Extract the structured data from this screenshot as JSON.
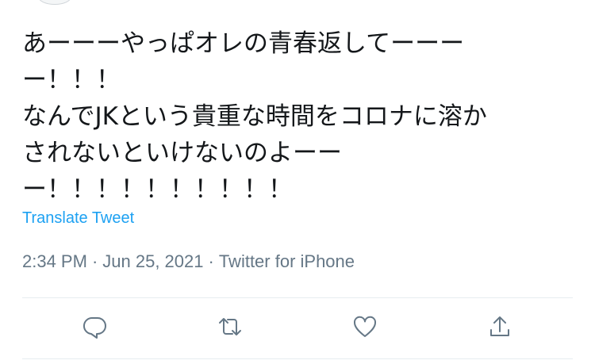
{
  "tweet": {
    "text_lines": [
      "あーーーやっぱオレの青春返してーーー",
      "ー！！！",
      "なんでJKという貴重な時間をコロナに溶か",
      "されないといけないのよーー",
      "ー！！！！！！！！！！"
    ],
    "translate_label": "Translate Tweet",
    "time": "2:34 PM",
    "date": "Jun 25, 2021",
    "source": "Twitter for iPhone",
    "separator": "·"
  },
  "actions": {
    "reply_icon": "reply-icon",
    "retweet_icon": "retweet-icon",
    "like_icon": "heart-icon",
    "share_icon": "share-icon",
    "icon_color": "#657786"
  },
  "colors": {
    "text": "#14171a",
    "link": "#1da1f2",
    "meta": "#657786",
    "divider": "#e6ecf0"
  }
}
